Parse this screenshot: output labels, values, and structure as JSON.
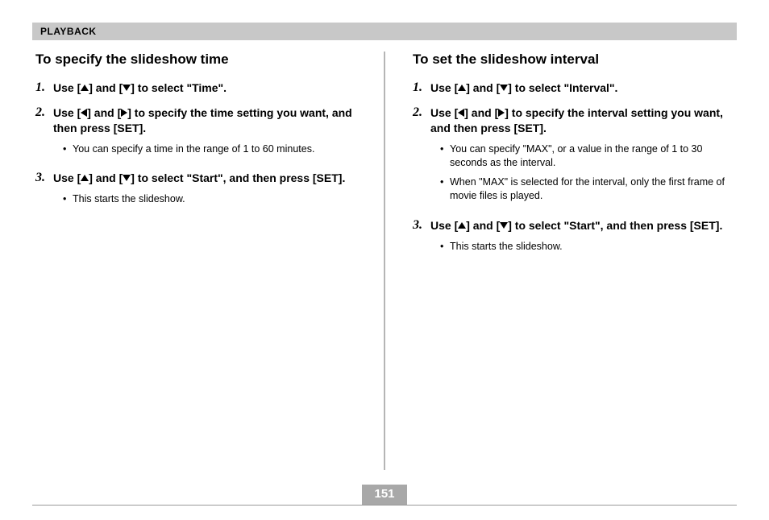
{
  "header": "PLAYBACK",
  "left": {
    "title": "To specify the slideshow time",
    "steps": [
      {
        "num": "1.",
        "pre": "Use [",
        "mid": "] and [",
        "post": "] to select \"Time\".",
        "iconA": "up",
        "iconB": "down",
        "bullets": []
      },
      {
        "num": "2.",
        "pre": "Use [",
        "mid": "] and [",
        "post": "] to specify the time setting you want, and then press [SET].",
        "iconA": "left",
        "iconB": "right",
        "bullets": [
          "You can specify a time in the range of 1 to 60 minutes."
        ]
      },
      {
        "num": "3.",
        "pre": "Use [",
        "mid": "] and [",
        "post": "] to select \"Start\", and then press [SET].",
        "iconA": "up",
        "iconB": "down",
        "bullets": [
          "This starts the slideshow."
        ]
      }
    ]
  },
  "right": {
    "title": "To set the slideshow interval",
    "steps": [
      {
        "num": "1.",
        "pre": "Use [",
        "mid": "] and [",
        "post": "] to select \"Interval\".",
        "iconA": "up",
        "iconB": "down",
        "bullets": []
      },
      {
        "num": "2.",
        "pre": "Use [",
        "mid": "] and [",
        "post": "] to specify the interval setting you want, and then press [SET].",
        "iconA": "left",
        "iconB": "right",
        "bullets": [
          "You can specify \"MAX\", or a value in the range of 1 to 30 seconds as the interval.",
          "When \"MAX\" is selected for the interval, only the first frame of movie files is played."
        ]
      },
      {
        "num": "3.",
        "pre": "Use [",
        "mid": "] and [",
        "post": "] to select \"Start\", and then press [SET].",
        "iconA": "up",
        "iconB": "down",
        "bullets": [
          "This starts the slideshow."
        ]
      }
    ]
  },
  "page": "151"
}
